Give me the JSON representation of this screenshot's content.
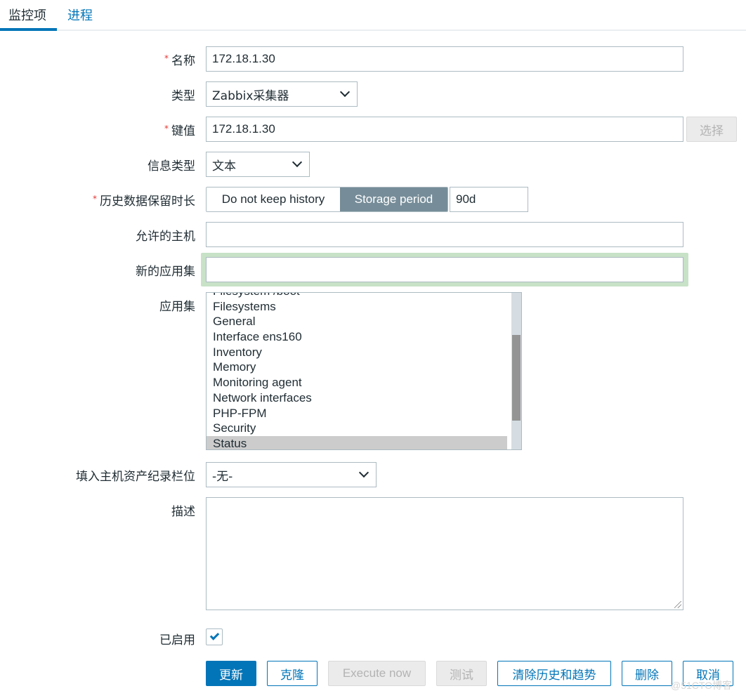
{
  "tabs": [
    {
      "label": "监控项",
      "active": true
    },
    {
      "label": "进程",
      "active": false
    }
  ],
  "form": {
    "name": {
      "label": "名称",
      "required": true,
      "value": "172.18.1.30"
    },
    "type": {
      "label": "类型",
      "value": "Zabbix采集器"
    },
    "key": {
      "label": "键值",
      "required": true,
      "value": "172.18.1.30",
      "select_button": "选择"
    },
    "info_type": {
      "label": "信息类型",
      "value": "文本"
    },
    "history": {
      "label": "历史数据保留时长",
      "required": true,
      "options": [
        "Do not keep history",
        "Storage period"
      ],
      "selected": "Storage period",
      "value": "90d"
    },
    "allowed_hosts": {
      "label": "允许的主机",
      "value": ""
    },
    "new_application": {
      "label": "新的应用集",
      "value": ""
    },
    "applications": {
      "label": "应用集",
      "items": [
        "Filesystem /boot",
        "Filesystems",
        "General",
        "Interface ens160",
        "Inventory",
        "Memory",
        "Monitoring agent",
        "Network interfaces",
        "PHP-FPM",
        "Security",
        "Status"
      ],
      "selected": "Status"
    },
    "inventory_field": {
      "label": "填入主机资产纪录栏位",
      "value": "-无-"
    },
    "description": {
      "label": "描述",
      "value": ""
    },
    "enabled": {
      "label": "已启用",
      "checked": true
    }
  },
  "buttons": {
    "update": "更新",
    "clone": "克隆",
    "execute_now": "Execute now",
    "test": "测试",
    "clear_history": "清除历史和趋势",
    "delete": "删除",
    "cancel": "取消"
  },
  "watermark": "@51CTO博客",
  "colors": {
    "accent": "#0275b8",
    "required": "#e33734",
    "segment_active": "#768d99",
    "focus": "#c7e2c7"
  }
}
